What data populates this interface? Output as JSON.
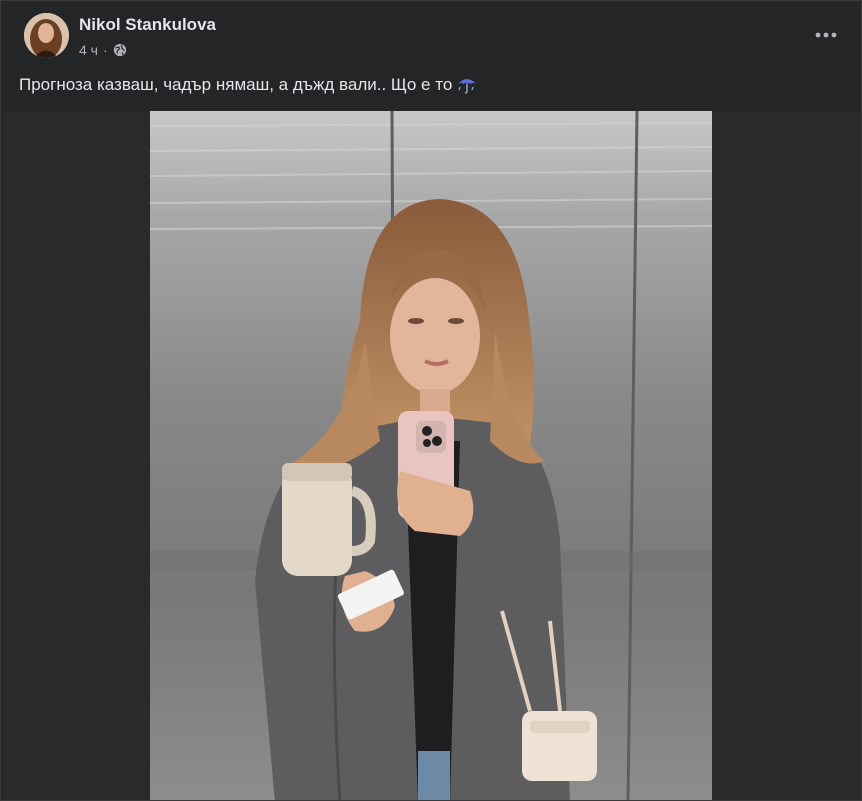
{
  "post": {
    "author": "Nikol Stankulova",
    "time": "4 ч",
    "caption": "Прогноза казваш, чадър нямаш, а дъжд вали.. Що е то"
  },
  "icons": {
    "avatar": "avatar-photo",
    "globe": "globe-icon",
    "more": "more-options-icon",
    "emoji": "umbrella-with-rain-icon"
  },
  "colors": {
    "background": "#242526",
    "text_primary": "#e4e6eb",
    "text_secondary": "#b0b3b8"
  }
}
